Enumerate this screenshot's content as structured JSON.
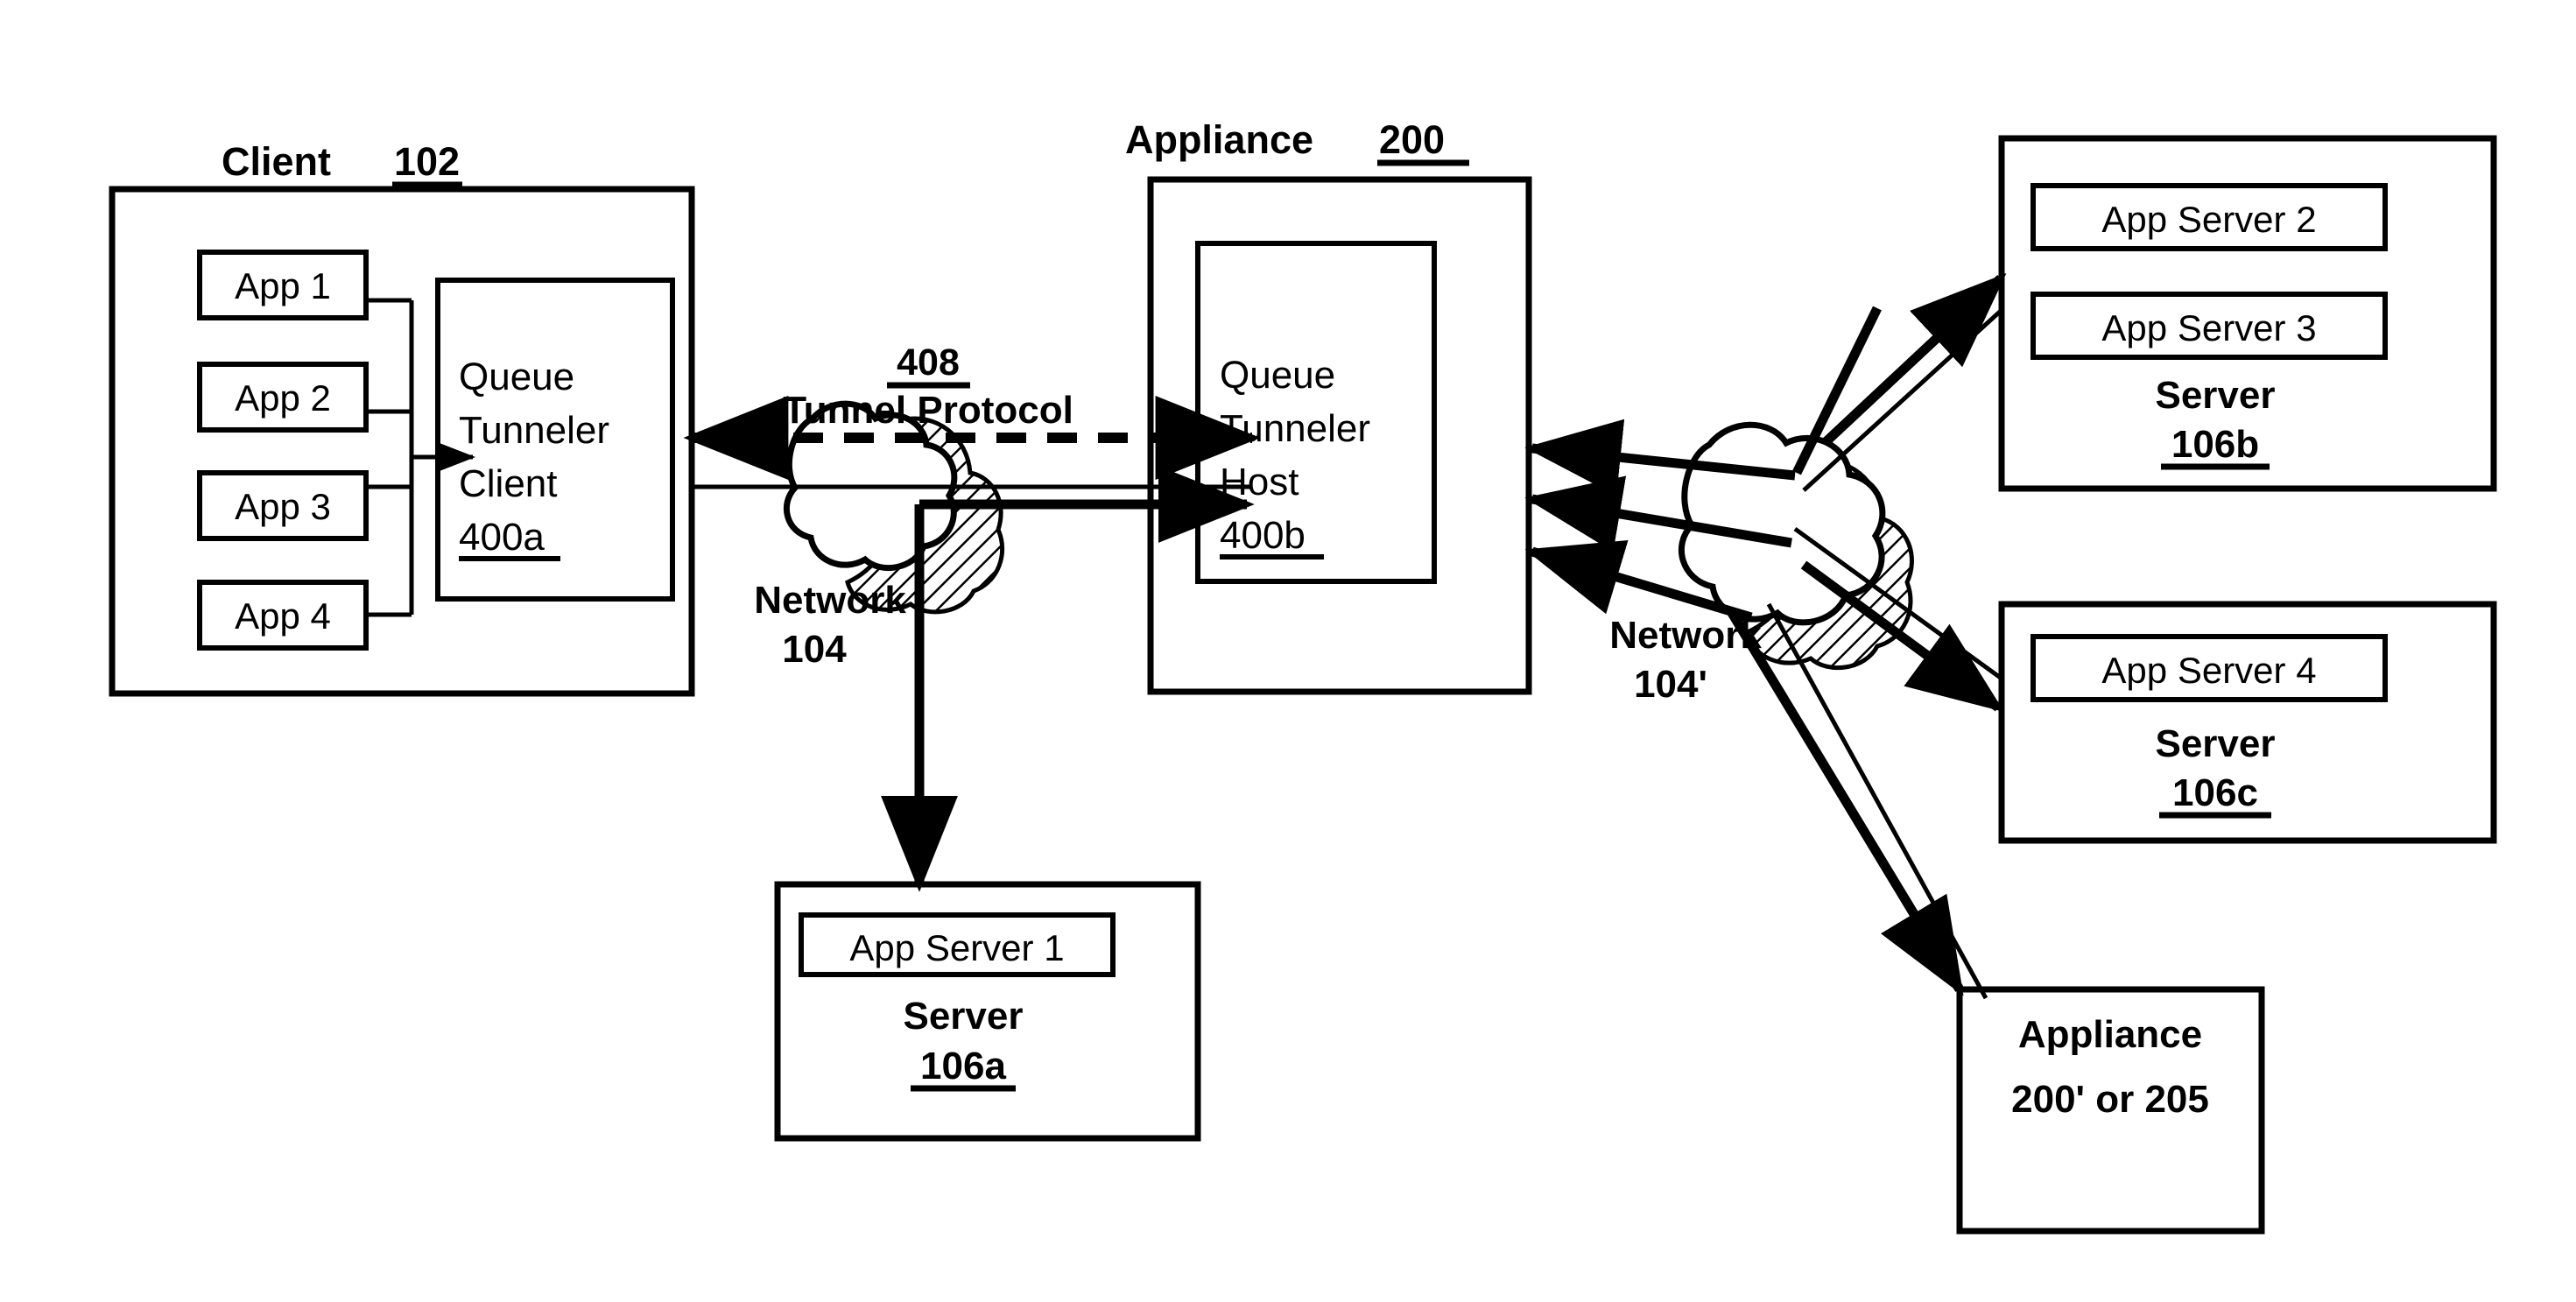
{
  "diagram": {
    "title_hint": "Queue Tunneler over Tunnel Protocol network diagram",
    "client": {
      "label": "Client",
      "ref": "102",
      "apps": [
        {
          "label": "App 1"
        },
        {
          "label": "App 2"
        },
        {
          "label": "App 3"
        },
        {
          "label": "App 4"
        }
      ],
      "tunneler": {
        "line1": "Queue",
        "line2": "Tunneler",
        "line3": "Client",
        "ref": "400a"
      }
    },
    "appliance": {
      "label": "Appliance",
      "ref": "200",
      "tunneler": {
        "line1": "Queue",
        "line2": "Tunneler",
        "line3": "Host",
        "ref": "400b"
      }
    },
    "tunnel": {
      "ref": "408",
      "label": "Tunnel Protocol"
    },
    "network_left": {
      "label": "Network",
      "ref": "104"
    },
    "network_right": {
      "label": "Network",
      "ref": "104'"
    },
    "server_106a": {
      "apps": [
        "App Server 1"
      ],
      "label": "Server",
      "ref": "106a"
    },
    "server_106b": {
      "apps": [
        "App Server 2",
        "App Server 3"
      ],
      "label": "Server",
      "ref": "106b"
    },
    "server_106c": {
      "apps": [
        "App Server 4"
      ],
      "label": "Server",
      "ref": "106c"
    },
    "appliance_alt": {
      "line1": "Appliance",
      "line2": "200' or 205"
    },
    "colors": {
      "stroke": "#000000",
      "fill": "#ffffff",
      "background": "#ffffff"
    }
  }
}
